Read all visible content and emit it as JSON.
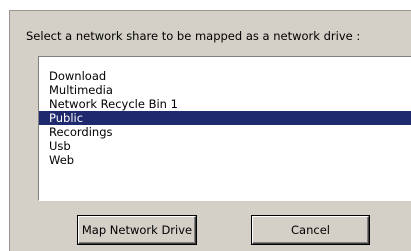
{
  "dialog": {
    "prompt": "Select a network share to be mapped as a network drive :"
  },
  "shares": {
    "items": [
      {
        "label": "Download",
        "selected": false
      },
      {
        "label": "Multimedia",
        "selected": false
      },
      {
        "label": "Network Recycle Bin 1",
        "selected": false
      },
      {
        "label": "Public",
        "selected": true
      },
      {
        "label": "Recordings",
        "selected": false
      },
      {
        "label": "Usb",
        "selected": false
      },
      {
        "label": "Web",
        "selected": false
      }
    ]
  },
  "buttons": {
    "map_label": "Map Network Drive",
    "cancel_label": "Cancel"
  },
  "colors": {
    "panel_bg": "#d4d0c8",
    "selection_bg": "#1f2a6e",
    "selection_text": "#ffffff"
  }
}
